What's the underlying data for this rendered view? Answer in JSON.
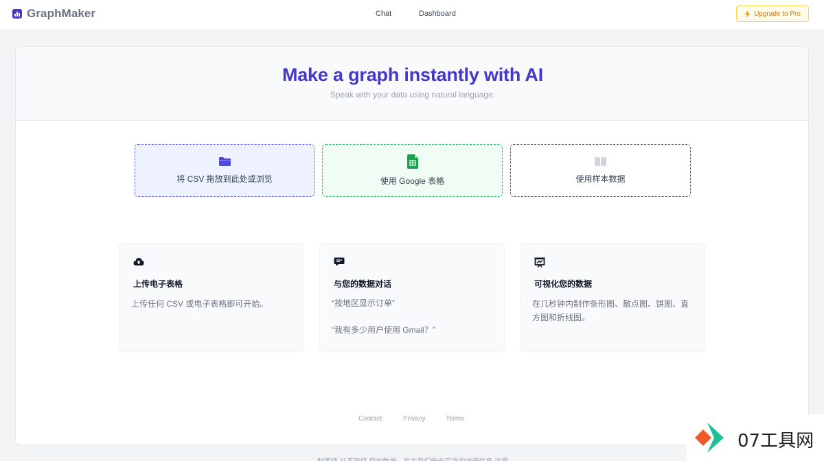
{
  "header": {
    "brand": "GraphMaker",
    "nav": [
      {
        "label": "Chat"
      },
      {
        "label": "Dashboard"
      }
    ],
    "upgrade_label": "Upgrade to Pro",
    "upgrade_icon": "lightning-icon"
  },
  "hero": {
    "title": "Make a graph instantly with AI",
    "subtitle": "Speak with your data using natural language."
  },
  "sources": [
    {
      "label": "将 CSV 拖放到此处或浏览",
      "icon": "folder-icon",
      "color": "#4f46e5"
    },
    {
      "label": "使用 Google 表格",
      "icon": "google-sheets-icon",
      "color": "#16a34a"
    },
    {
      "label": "使用样本数据",
      "icon": "book-icon",
      "color": "#9ca3af"
    }
  ],
  "features": [
    {
      "title": "上传电子表格",
      "icon": "cloud-upload-icon",
      "desc": "上传任何 CSV 或电子表格即可开始。"
    },
    {
      "title": "与您的数据对话",
      "icon": "chat-bubble-icon",
      "examples": [
        "“按地区显示订单”",
        "“我有多少用户使用 Gmail？”"
      ]
    },
    {
      "title": "可视化您的数据",
      "icon": "presentation-chart-icon",
      "desc": "在几秒钟内制作条形图、散点图、饼图、直方图和折线图。"
    }
  ],
  "footer": {
    "links": [
      "Contact",
      "Privacy",
      "Terms"
    ],
    "note": "制图师 从不存储 您的数据。有关我们安全实践的详细信息 这里"
  },
  "watermark": {
    "text": "07工具网"
  },
  "colors": {
    "accent": "#4338ca",
    "upgrade": "#d97706",
    "sheets": "#16a34a"
  }
}
